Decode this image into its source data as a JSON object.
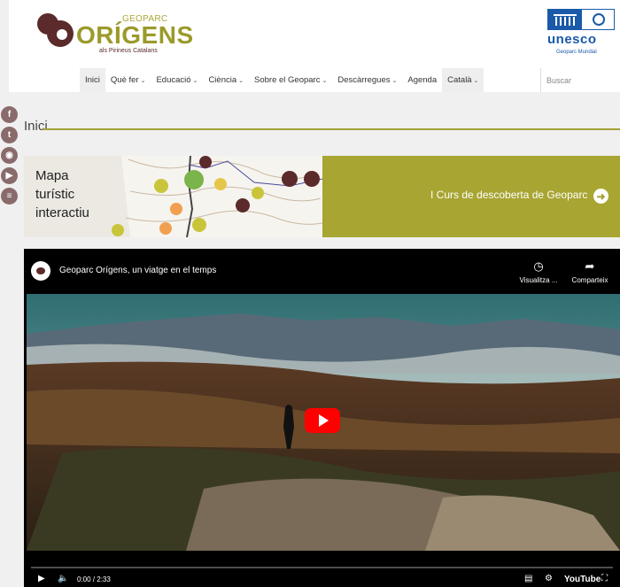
{
  "logo": {
    "top": "GEOPARC",
    "name": "ORÍGENS",
    "sub": "als Pirineus Catalans"
  },
  "unesco": {
    "word": "unesco",
    "sub": "Geoparc Mundial"
  },
  "nav": {
    "items": [
      {
        "label": "Inici",
        "has_menu": false
      },
      {
        "label": "Què fer",
        "has_menu": true
      },
      {
        "label": "Educació",
        "has_menu": true
      },
      {
        "label": "Ciència",
        "has_menu": true
      },
      {
        "label": "Sobre el Geoparc",
        "has_menu": true
      },
      {
        "label": "Descàrregues",
        "has_menu": true
      },
      {
        "label": "Agenda",
        "has_menu": false
      },
      {
        "label": "Català",
        "has_menu": true
      }
    ],
    "search_placeholder": "Buscar"
  },
  "social": [
    "facebook-icon",
    "twitter-icon",
    "instagram-icon",
    "youtube-icon",
    "rss-icon"
  ],
  "page": {
    "title": "Inici"
  },
  "banners": {
    "map": {
      "line1": "Mapa",
      "line2": "turístic",
      "line3": "interactiu"
    },
    "curs": {
      "label": "I Curs de descoberta de  Geoparc"
    }
  },
  "video": {
    "title": "Geoparc Orígens, un viatge en el temps",
    "watch_later": "Visualitza ...",
    "share": "Comparteix",
    "time": "0:00 / 2:33",
    "brand": "YouTube",
    "progress": 0
  },
  "colors": {
    "accent": "#a8a532",
    "brand_dark": "#5b2a2a",
    "unesco_blue": "#1a5aa8",
    "play_red": "#ff0000"
  }
}
